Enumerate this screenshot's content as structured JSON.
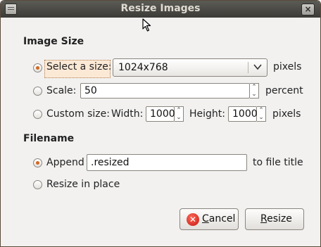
{
  "window": {
    "title": "Resize Images",
    "close_glyph": "×"
  },
  "image_size": {
    "heading": "Image Size",
    "options": [
      {
        "label": "Select a size:",
        "selected": true
      },
      {
        "label": "Scale:",
        "selected": false
      },
      {
        "label": "Custom size:",
        "selected": false
      }
    ],
    "size_combo": {
      "value": "1024x768",
      "unit": "pixels",
      "arrow_icon": "chevron-down-icon"
    },
    "scale": {
      "value": "50",
      "unit": "percent"
    },
    "custom": {
      "width_label": "Width:",
      "width_value": "1000",
      "height_label": "Height:",
      "height_value": "1000",
      "unit": "pixels"
    }
  },
  "filename": {
    "heading": "Filename",
    "append": {
      "label": "Append",
      "value": ".resized",
      "suffix": "to file title",
      "selected": true
    },
    "in_place": {
      "label": "Resize in place",
      "selected": false
    }
  },
  "buttons": {
    "cancel_first": "C",
    "cancel_rest": "ancel",
    "resize_first": "R",
    "resize_rest": "esize"
  },
  "colors": {
    "accent": "#d06920",
    "titlebar": "#3c3b37",
    "cancel_icon": "#c4160f"
  }
}
